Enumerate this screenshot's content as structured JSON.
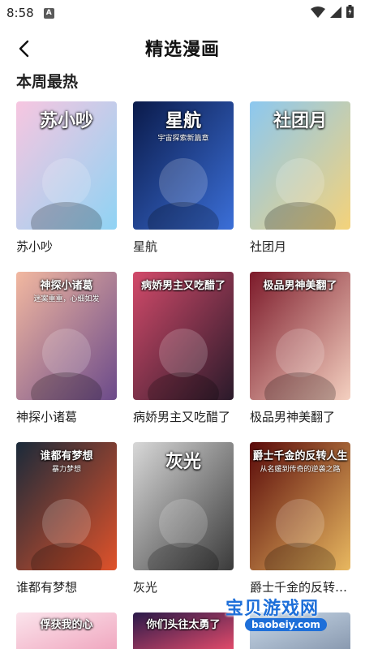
{
  "status_bar": {
    "time": "8:58",
    "notification_badge": "A"
  },
  "nav": {
    "title": "精选漫画"
  },
  "section": {
    "title": "本周最热"
  },
  "comics": [
    {
      "title": "苏小吵",
      "cover_text": "苏小吵",
      "palette": [
        "#f7c6e0",
        "#8fd3f4"
      ]
    },
    {
      "title": "星航",
      "cover_text": "星航",
      "cover_subtitle": "宇宙探索新篇章",
      "palette": [
        "#0a1a4a",
        "#3b6fd8"
      ]
    },
    {
      "title": "社团月",
      "cover_text": "社团月",
      "palette": [
        "#8cc8f0",
        "#f4d27a"
      ]
    },
    {
      "title": "神探小诸葛",
      "cover_text": "神探小诸葛",
      "cover_subtitle": "迷案重重，心细如发",
      "palette": [
        "#f2b8a0",
        "#6b4a8a"
      ]
    },
    {
      "title": "病娇男主又吃醋了",
      "cover_text": "病娇男主又吃醋了",
      "palette": [
        "#d24a6a",
        "#2a1a2a"
      ]
    },
    {
      "title": "极品男神美翻了",
      "cover_text": "极品男神美翻了",
      "palette": [
        "#7c1a2a",
        "#f4d0c0"
      ]
    },
    {
      "title": "谁都有梦想",
      "cover_text": "谁都有梦想",
      "cover_subtitle": "暴力梦想",
      "palette": [
        "#1a2a3a",
        "#e0522a"
      ]
    },
    {
      "title": "灰光",
      "cover_text": "灰光",
      "palette": [
        "#d8d8d8",
        "#3a3a3a"
      ]
    },
    {
      "title": "爵士千金的反转人生",
      "cover_text": "爵士千金的反转人生",
      "cover_subtitle": "从名媛到传奇的逆袭之路",
      "palette": [
        "#5a0a0a",
        "#e8b860"
      ]
    },
    {
      "title": "",
      "cover_text": "俘获我的心",
      "palette": [
        "#fbe4ec",
        "#f0a8c0"
      ]
    },
    {
      "title": "",
      "cover_text": "你们头往太勇了",
      "palette": [
        "#2a1a4a",
        "#e04a6a"
      ]
    },
    {
      "title": "",
      "cover_text": "",
      "palette": [
        "#c8d8e8",
        "#8a9ab0"
      ]
    }
  ],
  "watermark": {
    "text": "宝贝游戏网",
    "url": "baobeiy.com"
  },
  "colors": {
    "accent": "#1e6fd9",
    "text": "#222222",
    "background": "#ffffff"
  }
}
